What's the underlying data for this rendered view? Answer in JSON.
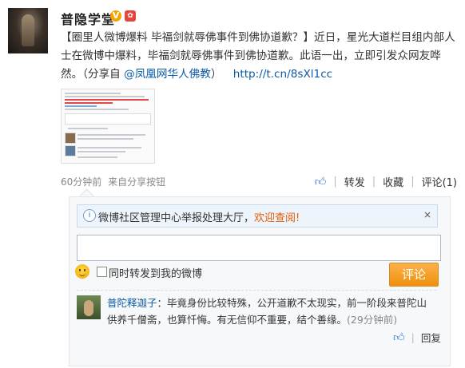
{
  "user": {
    "name": "普隐学堂",
    "verified_badge": "V",
    "medal_icon": "medal-icon"
  },
  "post": {
    "title": "【圈里人微博爆料 毕福剑就辱佛事件到佛协道歉？】",
    "body": "近日，星光大道栏目组内部人士在微博中爆料，毕福剑就辱佛事件到佛协道歉。此语一出，立即引发众网友哗然。（分享自 ",
    "share_source": "@凤凰网华人佛教",
    "close_paren": "）",
    "short_url": "http://t.cn/8sXl1cc"
  },
  "meta": {
    "time": "60分钟前",
    "source": "来自分享按钮",
    "actions": {
      "forward": "转发",
      "favorite": "收藏",
      "comment": "评论(1)"
    }
  },
  "comment_panel": {
    "notice_text": "微博社区管理中心举报处理大厅，",
    "notice_link": "欢迎查阅!",
    "close_label": "×",
    "input_value": "",
    "checkbox_label": "同时转发到我的微博",
    "submit_label": "评论"
  },
  "comments": [
    {
      "author": "普陀释迦子",
      "text": "：毕竟身份比较特殊，公开道歉不太现实，前一阶段来普陀山供养千僧斋，也算忏悔。有无信仰不重要，结个善缘。",
      "time": "(29分钟前)",
      "reply_label": "回复"
    }
  ],
  "colors": {
    "link": "#0b5aa6",
    "orange": "#f0900c",
    "notice_link": "#e55b00"
  }
}
